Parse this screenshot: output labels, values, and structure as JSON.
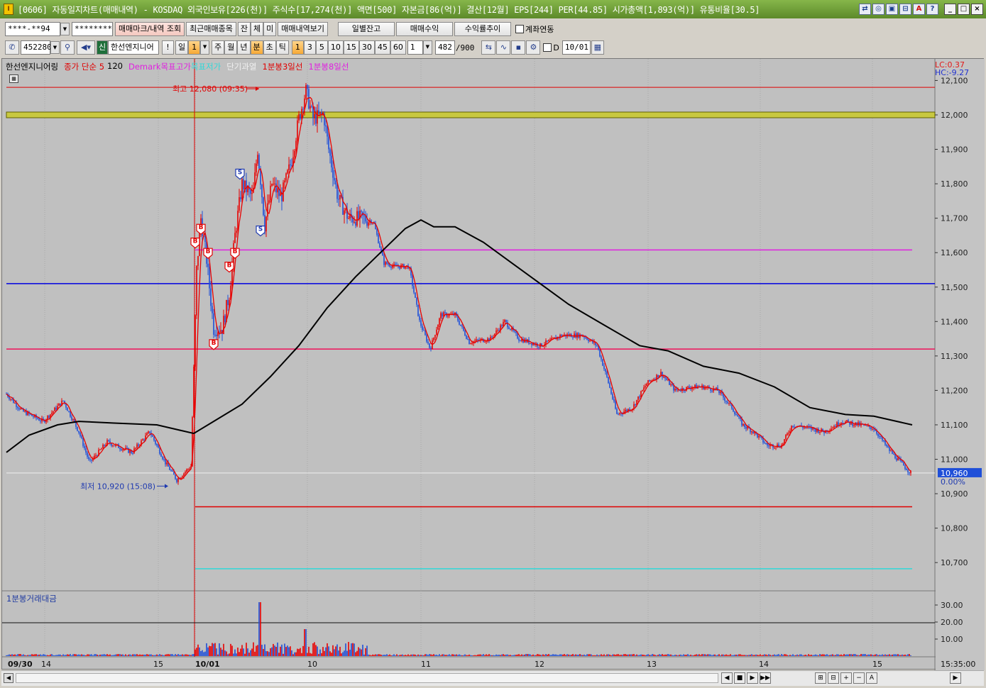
{
  "window": {
    "title": "[0606] 자동일지차트(매매내역) - KOSDAQ 외국인보유[226(천)] 주식수[17,274(천)] 액면[500] 자본금[86(억)] 결산[12월] EPS[244] PER[44.85] 시가총액[1,893(억)] 유통비율[30.5]",
    "icon": "I",
    "tool_buttons": [
      "⇄",
      "◎",
      "▣",
      "⊟",
      "A",
      "?"
    ],
    "sys_buttons": [
      "_",
      "□",
      "×"
    ]
  },
  "toolbar1": {
    "account": "****-**94",
    "password": "********",
    "buttons": [
      "매매마크/내역 조회",
      "최근매매종목",
      "잔",
      "체",
      "미",
      "매매내역보기"
    ],
    "buttons2": [
      "일별잔고",
      "매매수익",
      "수익률추이"
    ],
    "checkbox_label": "계좌연동"
  },
  "toolbar2": {
    "code": "452280",
    "badge": "신",
    "stock_name": "한선엔지니어",
    "periods": [
      "일",
      "1",
      "주",
      "월",
      "년",
      "분",
      "초",
      "틱"
    ],
    "minutes": [
      "1",
      "3",
      "5",
      "10",
      "15",
      "30",
      "45",
      "60"
    ],
    "count_value": "1",
    "count": "482",
    "count_total": "/900",
    "d_label": "D",
    "date": "10/01"
  },
  "chart": {
    "legend": [
      {
        "text": "한선엔지니어링",
        "color": "#000000"
      },
      {
        "text": "종가 단순 5",
        "color": "#e00000"
      },
      {
        "text": "120",
        "color": "#000000"
      },
      {
        "text": "Demark목표고가",
        "color": "#e020e0"
      },
      {
        "text": "목표저가",
        "color": "#30d8d8"
      },
      {
        "text": "단기과열",
        "color": "#f0f0f0"
      },
      {
        "text": "1분봉3일선",
        "color": "#e00000"
      },
      {
        "text": "1분봉8일선",
        "color": "#e020e0"
      }
    ],
    "lc": "LC:0.37",
    "hc": "HC:-9.27",
    "high_note": "최고 12,080 (09:35)",
    "low_note": "최저 10,920 (15:08)",
    "current_price": "10,960",
    "current_change": "0.00%",
    "price_ticks": [
      "12,100",
      "12,000",
      "11,900",
      "11,800",
      "11,700",
      "11,600",
      "11,500",
      "11,400",
      "11,300",
      "11,200",
      "11,100",
      "11,000",
      "10,900",
      "10,800",
      "10,700"
    ],
    "volume_label": "1분봉거래대금",
    "volume_ticks": [
      "30.00",
      "20.00",
      "10.00"
    ],
    "time_labels": [
      {
        "t": "09/30",
        "bold": true
      },
      {
        "t": "14",
        "bold": false
      },
      {
        "t": "15",
        "bold": false
      },
      {
        "t": "10/01",
        "bold": true
      },
      {
        "t": "10",
        "bold": false
      },
      {
        "t": "11",
        "bold": false
      },
      {
        "t": "12",
        "bold": false
      },
      {
        "t": "13",
        "bold": false
      },
      {
        "t": "14",
        "bold": false
      },
      {
        "t": "15",
        "bold": false
      }
    ],
    "time_right": "15:35:00",
    "buy_mark": "B",
    "sell_mark": "S",
    "colors": {
      "bg": "#c0c0c0",
      "up": "#e80000",
      "down": "#1f4fd8",
      "ma120": "#000000",
      "demark_high": "#e020e0",
      "demark_low": "#30d8d8",
      "blue_line": "#0000e0",
      "pink_line": "#f0105a",
      "red_line": "#e00000",
      "band": "#c8c840"
    }
  },
  "statusbar": {
    "controls": [
      "◀",
      "■",
      "▶",
      "▶▶",
      "⊞",
      "⊟",
      "+",
      "−",
      "A",
      "▶"
    ]
  }
}
